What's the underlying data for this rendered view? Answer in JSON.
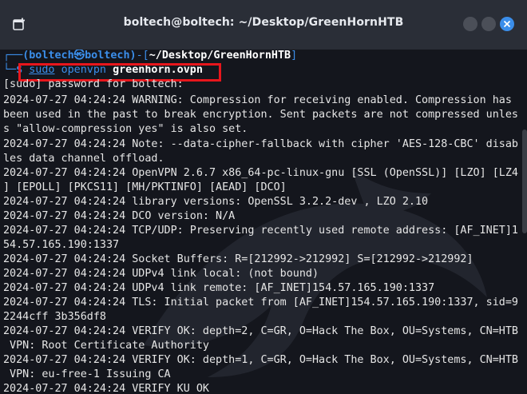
{
  "window": {
    "title": "boltech@boltech: ~/Desktop/GreenHornHTB",
    "accent_close": "#3b8eea",
    "annotation_color": "#e8161c"
  },
  "prompt": {
    "corner_top": "┌──",
    "user_host": "(boltech㉿boltech)",
    "path_open": "-[",
    "path": "~/Desktop/GreenHornHTB",
    "path_close": "]",
    "corner_bottom": "└─",
    "symbol": "$",
    "command": {
      "sudo": "sudo",
      "program": "openvpn",
      "argument": "greenhorn.ovpn"
    }
  },
  "output": [
    "[sudo] password for boltech:",
    "2024-07-27 04:24:24 WARNING: Compression for receiving enabled. Compression has",
    "been used in the past to break encryption. Sent packets are not compressed unles",
    "s \"allow-compression yes\" is also set.",
    "2024-07-27 04:24:24 Note: --data-cipher-fallback with cipher 'AES-128-CBC' disab",
    "les data channel offload.",
    "2024-07-27 04:24:24 OpenVPN 2.6.7 x86_64-pc-linux-gnu [SSL (OpenSSL)] [LZO] [LZ4",
    "] [EPOLL] [PKCS11] [MH/PKTINFO] [AEAD] [DCO]",
    "2024-07-27 04:24:24 library versions: OpenSSL 3.2.2-dev , LZO 2.10",
    "2024-07-27 04:24:24 DCO version: N/A",
    "2024-07-27 04:24:24 TCP/UDP: Preserving recently used remote address: [AF_INET]1",
    "54.57.165.190:1337",
    "2024-07-27 04:24:24 Socket Buffers: R=[212992->212992] S=[212992->212992]",
    "2024-07-27 04:24:24 UDPv4 link local: (not bound)",
    "2024-07-27 04:24:24 UDPv4 link remote: [AF_INET]154.57.165.190:1337",
    "2024-07-27 04:24:24 TLS: Initial packet from [AF_INET]154.57.165.190:1337, sid=9",
    "2244cff 3b356df8",
    "2024-07-27 04:24:24 VERIFY OK: depth=2, C=GR, O=Hack The Box, OU=Systems, CN=HTB",
    " VPN: Root Certificate Authority",
    "2024-07-27 04:24:24 VERIFY OK: depth=1, C=GR, O=Hack The Box, OU=Systems, CN=HTB",
    " VPN: eu-free-1 Issuing CA",
    "2024-07-27 04:24:24 VERIFY KU OK"
  ]
}
